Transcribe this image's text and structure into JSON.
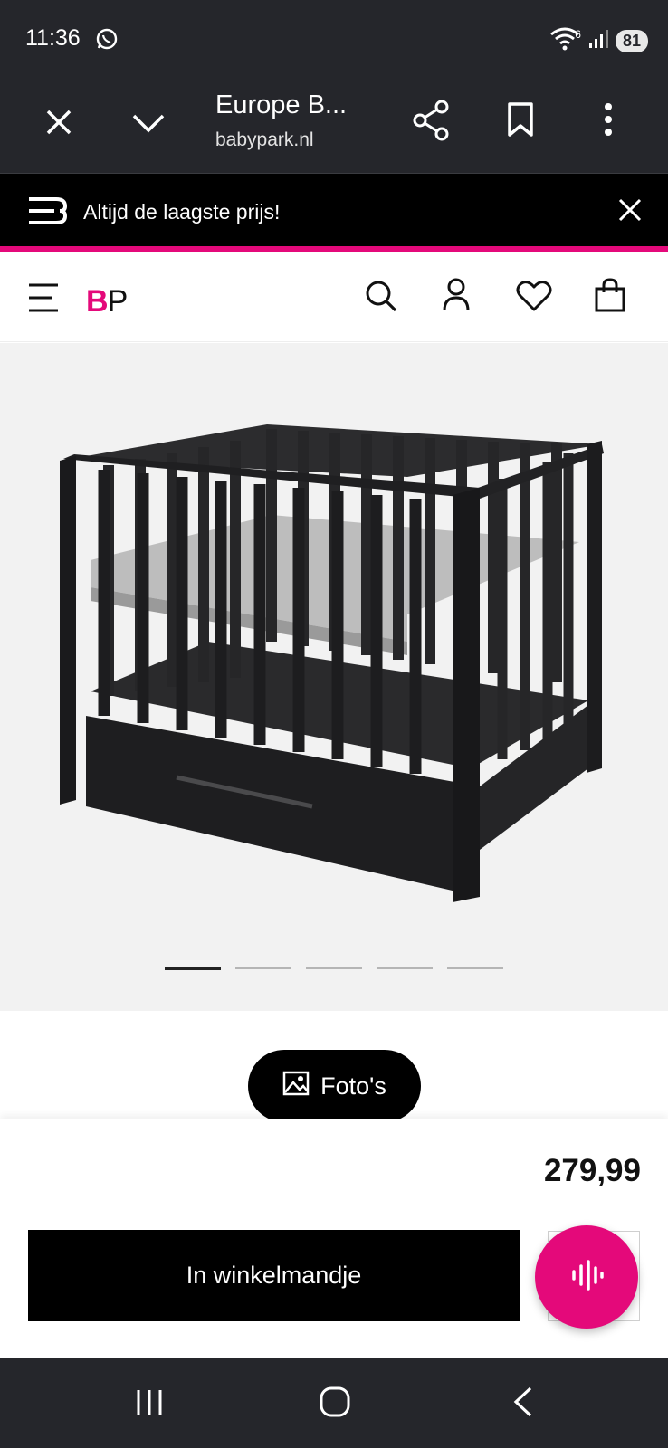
{
  "status_bar": {
    "time": "11:36",
    "network_badge": "6",
    "battery": "81"
  },
  "browser": {
    "tab_title": "Europe B...",
    "tab_url": "babypark.nl"
  },
  "promo": {
    "text": "Altijd de laagste prijs!"
  },
  "header": {
    "logo_b": "B",
    "logo_p": "P"
  },
  "gallery": {
    "image_count": 5,
    "active_index": 0
  },
  "photos_button": {
    "label": "Foto's"
  },
  "product": {
    "price": "279,99"
  },
  "cart_button": {
    "label": "In winkelmandje"
  },
  "colors": {
    "brand": "#e4097a",
    "dark_chrome": "#25262b"
  }
}
